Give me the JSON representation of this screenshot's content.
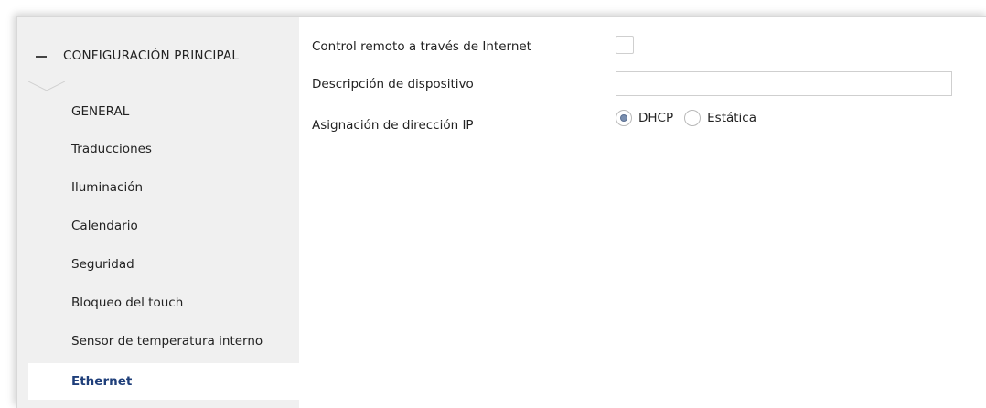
{
  "sidebar": {
    "header": {
      "label": "CONFIGURACIÓN PRINCIPAL",
      "collapse_symbol": "−"
    },
    "items": [
      {
        "label": "GENERAL",
        "active": false
      },
      {
        "label": "Traducciones",
        "active": false
      },
      {
        "label": "Iluminación",
        "active": false
      },
      {
        "label": "Calendario",
        "active": false
      },
      {
        "label": "Seguridad",
        "active": false
      },
      {
        "label": "Bloqueo del touch",
        "active": false
      },
      {
        "label": "Sensor de temperatura interno",
        "active": false
      },
      {
        "label": "Ethernet",
        "active": true
      }
    ]
  },
  "form": {
    "remote_control": {
      "label": "Control remoto a través de Internet",
      "checked": false
    },
    "device_description": {
      "label": "Descripción de dispositivo",
      "value": ""
    },
    "ip_assignment": {
      "label": "Asignación de dirección IP",
      "options": [
        {
          "label": "DHCP",
          "selected": true
        },
        {
          "label": "Estática",
          "selected": false
        }
      ]
    }
  },
  "colors": {
    "sidebar_bg": "#f0f0f0",
    "active_text": "#1f3f7a",
    "radio_fill": "#7a8faf"
  }
}
